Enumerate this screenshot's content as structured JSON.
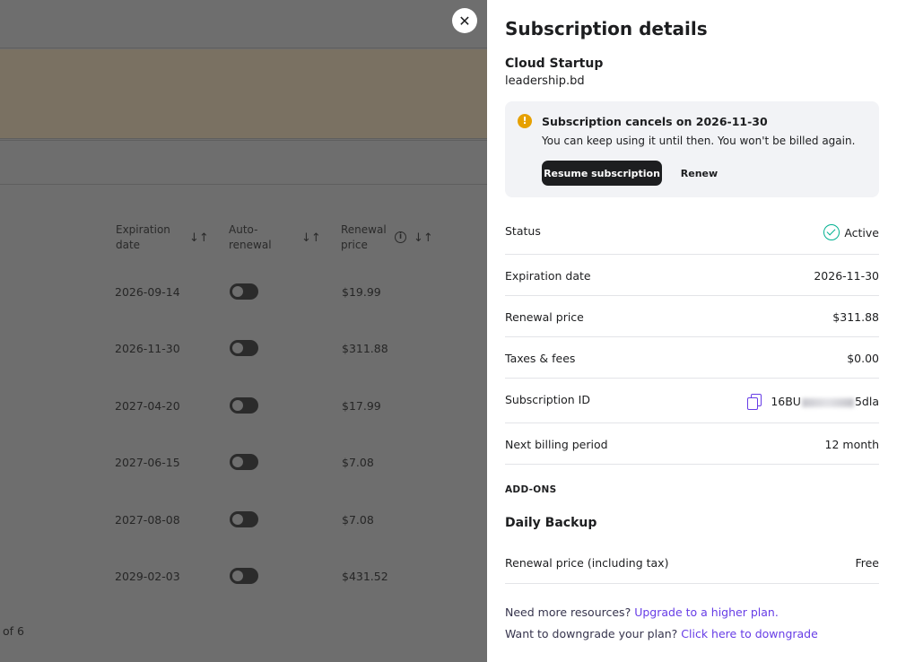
{
  "background": {
    "table_headers": {
      "expiration": "Expiration date",
      "auto_renewal": "Auto-renewal",
      "renewal_price": "Renewal price"
    },
    "rows": [
      {
        "date": "2026-09-14",
        "price": "$19.99"
      },
      {
        "date": "2026-11-30",
        "price": "$311.88"
      },
      {
        "date": "2027-04-20",
        "price": "$17.99"
      },
      {
        "date": "2027-06-15",
        "price": "$7.08"
      },
      {
        "date": "2027-08-08",
        "price": "$7.08"
      },
      {
        "date": "2029-02-03",
        "price": "$431.52"
      }
    ],
    "pager": "of 6"
  },
  "panel": {
    "title": "Subscription details",
    "plan": "Cloud Startup",
    "domain": "leadership.bd",
    "alert": {
      "title": "Subscription cancels on 2026-11-30",
      "text": "You can keep using it until then. You won't be billed again.",
      "resume_label": "Resume subscription",
      "renew_label": "Renew"
    },
    "details": {
      "status_label": "Status",
      "status_value": "Active",
      "expiration_label": "Expiration date",
      "expiration_value": "2026-11-30",
      "renewal_label": "Renewal price",
      "renewal_value": "$311.88",
      "taxes_label": "Taxes & fees",
      "taxes_value": "$0.00",
      "sub_id_label": "Subscription ID",
      "sub_id_prefix": "16BU",
      "sub_id_suffix": "5dla",
      "billing_label": "Next billing period",
      "billing_value": "12 month"
    },
    "addons": {
      "section_label": "ADD-ONS",
      "name": "Daily Backup",
      "price_label": "Renewal price (including tax)",
      "price_value": "Free"
    },
    "footer": {
      "upgrade_text": "Need more resources?",
      "upgrade_link": "Upgrade to a higher plan.",
      "downgrade_text": "Want to downgrade your plan?",
      "downgrade_link": "Click here to downgrade"
    }
  },
  "colors": {
    "accent": "#673de6",
    "active": "#00b090",
    "warning": "#e6a000",
    "dark": "#1d1e20"
  }
}
